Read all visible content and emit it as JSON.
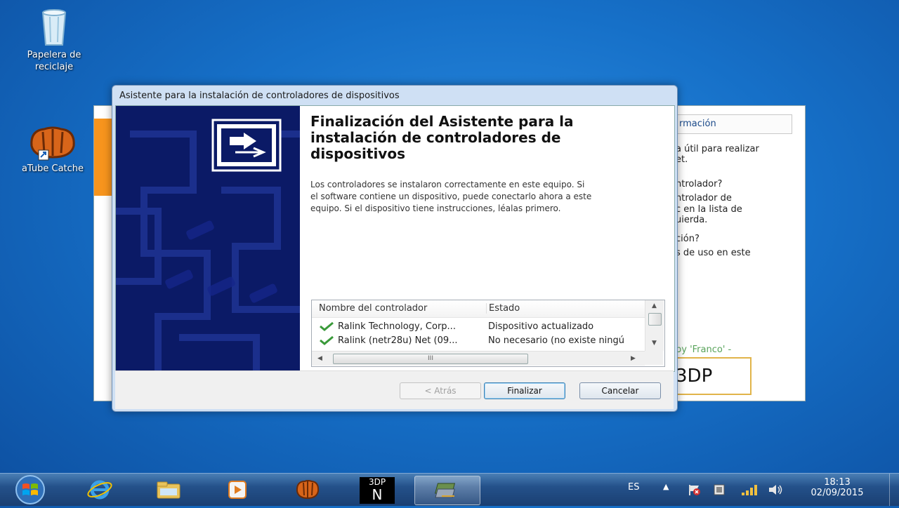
{
  "desktop": {
    "recycle_bin_label_line1": "Papelera de",
    "recycle_bin_label_line2": "reciclaje",
    "atube_label": "aTube Catche"
  },
  "background_window": {
    "tab_label": "rmación",
    "text_lines": [
      "a útil para realizar",
      "et.",
      "ntrolador?",
      "ntrolador de",
      "c en la lista de",
      "uierda.",
      "ción?",
      "s de uso en este"
    ],
    "credit": "by 'Franco' -",
    "logo_text": "3DP"
  },
  "dialog": {
    "title": "Asistente para la instalación de controladores de dispositivos",
    "heading_line1": "Finalización del Asistente para la",
    "heading_line2": "instalación de controladores de",
    "heading_line3": "dispositivos",
    "description_line1": "Los controladores se instalaron correctamente en este equipo. Si",
    "description_line2": "el software contiene un dispositivo, puede conectarlo ahora a este",
    "description_line3": "equipo. Si el dispositivo tiene instrucciones, léalas primero.",
    "list": {
      "columns": [
        "Nombre del controlador",
        "Estado"
      ],
      "rows": [
        {
          "name": "Ralink Technology, Corp...",
          "status": "Dispositivo actualizado"
        },
        {
          "name": "Ralink (netr28u) Net  (09...",
          "status": "No necesario (no existe ningú"
        }
      ],
      "hscroll_grip": "III"
    },
    "buttons": {
      "back": "< Atrás",
      "finish": "Finalizar",
      "cancel": "Cancelar"
    }
  },
  "taskbar": {
    "language": "ES",
    "time": "18:13",
    "date": "02/09/2015",
    "app_3dp_line1": "3DP",
    "app_3dp_line2": "N"
  },
  "colors": {
    "desktop": "#1670c8",
    "dialog_side_panel": "#0b1a66",
    "checkmark": "#3a9a3a",
    "taskbar": "#24518a"
  }
}
